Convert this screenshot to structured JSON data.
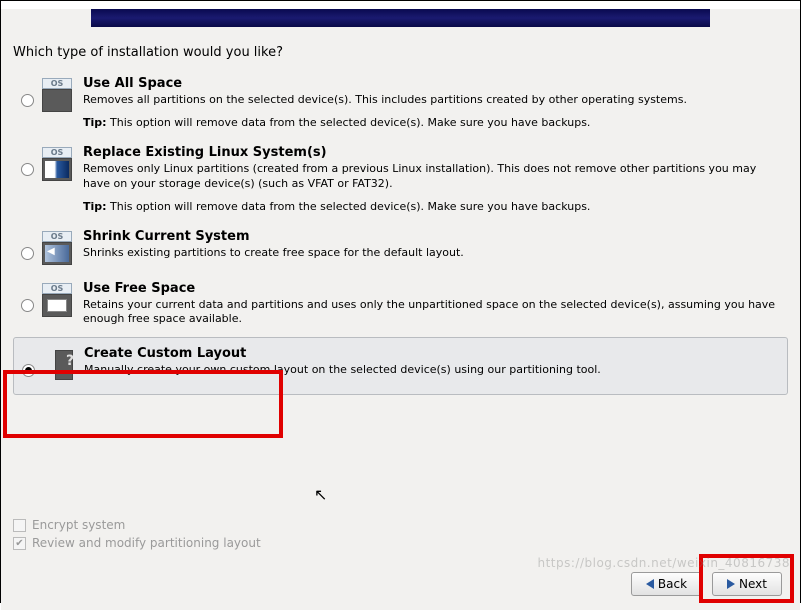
{
  "question": "Which type of installation would you like?",
  "options": [
    {
      "title": "Use All Space",
      "desc": "Removes all partitions on the selected device(s).  This includes partitions created by other operating systems.",
      "tip_label": "Tip:",
      "tip": "This option will remove data from the selected device(s).  Make sure you have backups.",
      "os_tag": "OS"
    },
    {
      "title": "Replace Existing Linux System(s)",
      "desc": "Removes only Linux partitions (created from a previous Linux installation).  This does not remove other partitions you may have on your storage device(s) (such as VFAT or FAT32).",
      "tip_label": "Tip:",
      "tip": "This option will remove data from the selected device(s).  Make sure you have backups.",
      "os_tag": "OS"
    },
    {
      "title": "Shrink Current System",
      "desc": "Shrinks existing partitions to create free space for the default layout.",
      "os_tag": "OS"
    },
    {
      "title": "Use Free Space",
      "desc": "Retains your current data and partitions and uses only the unpartitioned space on the selected device(s), assuming you have enough free space available.",
      "os_tag": "OS"
    },
    {
      "title": "Create Custom Layout",
      "desc": "Manually create your own custom layout on the selected device(s) using our partitioning tool."
    }
  ],
  "checkboxes": {
    "encrypt": "Encrypt system",
    "review": "Review and modify partitioning layout"
  },
  "buttons": {
    "back": "Back",
    "next": "Next"
  },
  "watermark": "https://blog.csdn.net/weixin_40816738"
}
